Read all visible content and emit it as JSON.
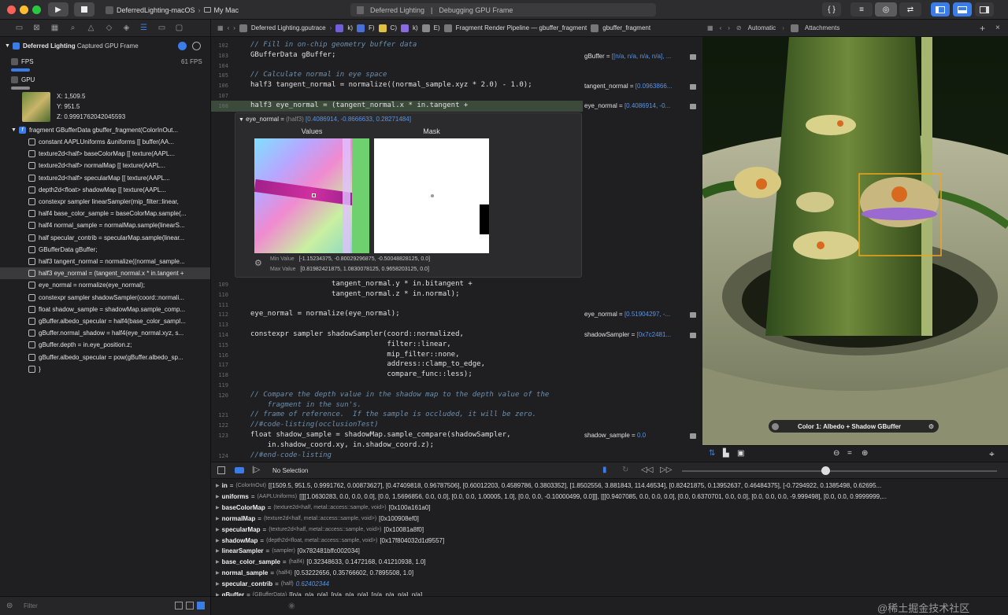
{
  "toolbar": {
    "scheme_target": "DeferredLighting-macOS",
    "scheme_device": "My Mac",
    "activity_file": "Deferred Lighting",
    "activity_status": "Debugging GPU Frame",
    "editor_mode_icons": [
      "curly-braces-icon",
      "list-icon",
      "overlap-icon",
      "swap-icon"
    ],
    "layout_icons": [
      "left-panel-icon",
      "bottom-panel-icon",
      "right-panel-icon"
    ]
  },
  "navigator": {
    "title": "Deferred Lighting",
    "subtitle": "Captured GPU Frame",
    "fps_label": "FPS",
    "fps_value": "61 FPS",
    "gpu_label": "GPU",
    "pixel_x": "X:  1,509.5",
    "pixel_y": "Y:  951.5",
    "pixel_z": "Z:  0.9991762042045593",
    "func_row": "fragment GBufferData gbuffer_fragment(ColorInOut...",
    "rows": [
      "constant AAPLUniforms &uniforms   [[ buffer(AA...",
      "texture2d<half>      baseColorMap  [[ texture(AAPL...",
      "texture2d<half>      normalMap  [[ texture(AAPL...",
      "texture2d<half>      specularMap  [[ texture(AAPL...",
      "depth2d<float>       shadowMap  [[ texture(AAPL...",
      "constexpr sampler linearSampler(mip_filter::linear,",
      "half4 base_color_sample = baseColorMap.sample(...",
      "half4 normal_sample = normalMap.sample(linearS...",
      "half specular_contrib = specularMap.sample(linear...",
      "GBufferData gBuffer;",
      "half3 tangent_normal = normalize((normal_sample...",
      "half3 eye_normal = (tangent_normal.x * in.tangent +",
      "eye_normal = normalize(eye_normal);",
      "constexpr sampler shadowSampler(coord::normali...",
      "float shadow_sample = shadowMap.sample_comp...",
      "gBuffer.albedo_specular = half4(base_color_sampl...",
      "gBuffer.normal_shadow = half4(eye_normal.xyz, s...",
      "gBuffer.depth = in.eye_position.z;",
      "gBuffer.albedo_specular = pow(gBuffer.albedo_sp...",
      "}"
    ],
    "selected_index": 11,
    "filter_placeholder": "Filter"
  },
  "jumpbar": {
    "file": "Deferred Lighting.gputrace",
    "c1": "k)",
    "c2": "F)",
    "c3": "C)",
    "c4": "k)",
    "c5": "E)",
    "pipeline": "Fragment Render Pipeline — gbuffer_fragment",
    "func": "gbuffer_fragment"
  },
  "editor": {
    "lines_top": [
      {
        "n": "102",
        "t": "cm",
        "s": "// Fill in on-chip geometry buffer data"
      },
      {
        "n": "103",
        "t": "plain",
        "s": "GBufferData gBuffer;"
      },
      {
        "n": "104",
        "t": "plain",
        "s": ""
      },
      {
        "n": "105",
        "t": "cm",
        "s": "// Calculate normal in eye space"
      },
      {
        "n": "106",
        "t": "plain",
        "s": "half3 tangent_normal = normalize((normal_sample.xyz * 2.0) - 1.0);"
      },
      {
        "n": "107",
        "t": "plain",
        "s": ""
      },
      {
        "n": "108",
        "t": "plain",
        "s": "half3 eye_normal = (tangent_normal.x * in.tangent +"
      }
    ],
    "lines_bottom": [
      {
        "n": "109",
        "t": "plain",
        "s": "                   tangent_normal.y * in.bitangent +"
      },
      {
        "n": "110",
        "t": "plain",
        "s": "                   tangent_normal.z * in.normal);"
      },
      {
        "n": "111",
        "t": "plain",
        "s": ""
      },
      {
        "n": "112",
        "t": "plain",
        "s": "eye_normal = normalize(eye_normal);"
      },
      {
        "n": "113",
        "t": "plain",
        "s": ""
      },
      {
        "n": "114",
        "t": "plain",
        "s": "constexpr sampler shadowSampler(coord::normalized,"
      },
      {
        "n": "115",
        "t": "plain",
        "s": "                                filter::linear,"
      },
      {
        "n": "116",
        "t": "plain",
        "s": "                                mip_filter::none,"
      },
      {
        "n": "117",
        "t": "plain",
        "s": "                                address::clamp_to_edge,"
      },
      {
        "n": "118",
        "t": "plain",
        "s": "                                compare_func::less);"
      },
      {
        "n": "119",
        "t": "plain",
        "s": ""
      },
      {
        "n": "120",
        "t": "cm",
        "s": "// Compare the depth value in the shadow map to the depth value of the"
      },
      {
        "n": "",
        "t": "cm",
        "s": "    fragment in the sun's."
      },
      {
        "n": "121",
        "t": "cm",
        "s": "// frame of reference.  If the sample is occluded, it will be zero."
      },
      {
        "n": "122",
        "t": "cm",
        "s": "//#code-listing(occlusionTest)"
      },
      {
        "n": "123",
        "t": "plain",
        "s": "float shadow_sample = shadowMap.sample_compare(shadowSampler,"
      },
      {
        "n": "",
        "t": "plain",
        "s": "    in.shadow_coord.xy, in.shadow_coord.z);"
      },
      {
        "n": "124",
        "t": "cm",
        "s": "//#end-code-listing"
      }
    ]
  },
  "popup": {
    "var_label": "eye_normal =",
    "var_type": "(half3)",
    "var_value": "[0.4086914, -0.8666633, 0.28271484]",
    "values_title": "Values",
    "mask_title": "Mask",
    "min_label": "Min Value",
    "min_value": "[-1.15234375, -0.80029296875, -0.50048828125, 0.0]",
    "max_label": "Max Value",
    "max_value": "[0.81982421875, 1.0830078125, 0.9658203125, 0.0]"
  },
  "values_column": [
    {
      "label": "gBuffer =",
      "value": "[[n/a, n/a, n/a, n/a], ..."
    },
    {
      "label": "tangent_normal =",
      "value": "[0.0963866..."
    },
    {
      "label": "eye_normal =",
      "value": "[0.4086914, -0..."
    },
    {
      "label": "eye_normal =",
      "value": "[0.51904297, -..."
    },
    {
      "label": "shadowSampler =",
      "value": "[0x7c2481..."
    },
    {
      "label": "shadow_sample =",
      "value": "0.0"
    }
  ],
  "assistant": {
    "mode": "Automatic",
    "title": "Attachments",
    "attachment_label": "Color 1: Albedo + Shadow GBuffer"
  },
  "debugbar": {
    "selection": "No Selection"
  },
  "variables": [
    {
      "name": "in",
      "type": "(ColorInOut)",
      "value": "[[1509.5, 951.5, 0.9991762, 0.00873627], [0.47409818, 0.96787506], [0.60012203, 0.4589786, 0.3803352], [1.8502556, 3.881843, 114.46534], [0.82421875, 0.13952637, 0.46484375], [-0.7294922, 0.1385498, 0.62695..."
    },
    {
      "name": "uniforms",
      "type": "(AAPLUniforms)",
      "value": "[[[[1.0630283, 0.0, 0.0, 0.0], [0.0, 1.5696856, 0.0, 0.0], [0.0, 0.0, 1.00005, 1.0], [0.0, 0.0, -0.10000499, 0.0]]], [[[0.9407085, 0.0, 0.0, 0.0], [0.0, 0.6370701, 0.0, 0.0], [0.0, 0.0, 0.0, -9.999498], [0.0, 0.0, 0.9999999,..."
    },
    {
      "name": "baseColorMap",
      "type": "(texture2d<half, metal::access::sample, void>)",
      "value": "[0x100a161a0]"
    },
    {
      "name": "normalMap",
      "type": "(texture2d<half, metal::access::sample, void>)",
      "value": "[0x100908ef0]"
    },
    {
      "name": "specularMap",
      "type": "(texture2d<half, metal::access::sample, void>)",
      "value": "[0x10081a8f0]"
    },
    {
      "name": "shadowMap",
      "type": "(depth2d<float, metal::access::sample, void>)",
      "value": "[0x17f804032d1d9557]"
    },
    {
      "name": "linearSampler",
      "type": "(sampler)",
      "value": "[0x782481bffc002034]"
    },
    {
      "name": "base_color_sample",
      "type": "(half4)",
      "value": "[0.32348633, 0.1472168, 0.41210938, 1.0]"
    },
    {
      "name": "normal_sample",
      "type": "(half4)",
      "value": "[0.53222656, 0.35766602, 0.7895508, 1.0]"
    },
    {
      "name": "specular_contrib",
      "type": "(half)",
      "value": "0.62402344"
    },
    {
      "name": "gBuffer",
      "type": "(GBufferData)",
      "value": "[[n/a, n/a, n/a], [n/a, n/a, n/a], [n/a, n/a, n/a], n/a]"
    }
  ],
  "console": {
    "watermark": "@稀土掘金技术社区"
  },
  "colors": {
    "accent": "#3a7ce8",
    "highlight_line": "#3b4a3a",
    "value_blue": "#5b93e0",
    "selection_box": "#f2a51a"
  }
}
